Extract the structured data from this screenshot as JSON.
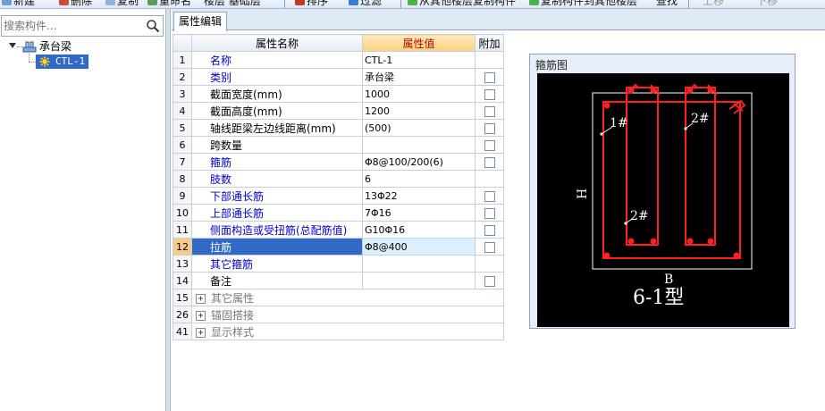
{
  "toolbar": {
    "items": [
      "新建",
      "删除",
      "复制",
      "重命名",
      "楼层 基础层",
      "排序",
      "过滤",
      "从其他楼层复制构件",
      "复制构件到其他楼层",
      "查找",
      "上移",
      "下移"
    ]
  },
  "left_panel": {
    "search_placeholder": "搜索构件...",
    "tree": {
      "root_label": "承台梁",
      "child_label": "CTL-1"
    }
  },
  "tab": {
    "label": "属性编辑"
  },
  "grid": {
    "headers": {
      "num": "",
      "name": "属性名称",
      "value": "属性值",
      "extra": "附加"
    },
    "rows": [
      {
        "num": "1",
        "name": "名称",
        "value": "CTL-1",
        "blue": true,
        "checkbox": false
      },
      {
        "num": "2",
        "name": "类别",
        "value": "承台梁",
        "blue": true,
        "checkbox": true
      },
      {
        "num": "3",
        "name": "截面宽度(mm)",
        "value": "1000",
        "blue": false,
        "checkbox": true
      },
      {
        "num": "4",
        "name": "截面高度(mm)",
        "value": "1200",
        "blue": false,
        "checkbox": true
      },
      {
        "num": "5",
        "name": "轴线距梁左边线距离(mm)",
        "value": "(500)",
        "blue": false,
        "checkbox": true
      },
      {
        "num": "6",
        "name": "跨数量",
        "value": "",
        "blue": false,
        "checkbox": true
      },
      {
        "num": "7",
        "name": "箍筋",
        "value": "Φ8@100/200(6)",
        "blue": true,
        "checkbox": true
      },
      {
        "num": "8",
        "name": "肢数",
        "value": "6",
        "blue": true,
        "checkbox": false
      },
      {
        "num": "9",
        "name": "下部通长筋",
        "value": "13Φ22",
        "blue": true,
        "checkbox": true
      },
      {
        "num": "10",
        "name": "上部通长筋",
        "value": "7Φ16",
        "blue": true,
        "checkbox": true
      },
      {
        "num": "11",
        "name": "侧面构造或受扭筋(总配筋值)",
        "value": "G10Φ16",
        "blue": true,
        "checkbox": true
      },
      {
        "num": "12",
        "name": "拉筋",
        "value": "Φ8@400",
        "blue": true,
        "checkbox": true,
        "selected": true
      },
      {
        "num": "13",
        "name": "其它箍筋",
        "value": "",
        "blue": true,
        "checkbox": false
      },
      {
        "num": "14",
        "name": "备注",
        "value": "",
        "blue": false,
        "checkbox": true
      },
      {
        "num": "15",
        "name": "其它属性",
        "value": "",
        "group": true
      },
      {
        "num": "26",
        "name": "锚固搭接",
        "value": "",
        "group": true
      },
      {
        "num": "41",
        "name": "显示样式",
        "value": "",
        "group": true
      }
    ]
  },
  "stirrup": {
    "panel_title": "箍筋图",
    "label_1": "1#",
    "label_2a": "2#",
    "label_2b": "2#",
    "label_h": "H",
    "label_b": "B",
    "type_label": "6-1型",
    "colors": {
      "rebar": "#ff2020",
      "outline": "#ffffff",
      "background": "#000000"
    }
  }
}
